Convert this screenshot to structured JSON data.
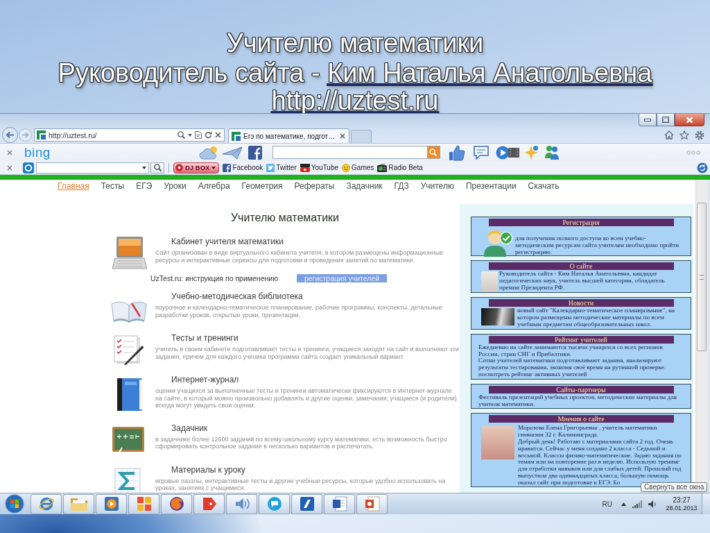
{
  "slide": {
    "title": "Учителю математики",
    "subtitle": "Руководитель сайта - ",
    "author_link": "Ким Наталья Анатольевна",
    "url_link": "http://uztest.ru"
  },
  "browser": {
    "address": "http://uztest.ru/",
    "tabs": [
      {
        "label": "Егэ по математике, подгот…",
        "selected": true
      }
    ],
    "toolbar": {
      "logo": "bing"
    },
    "links_bar": {
      "dj_button": "DJ BOX",
      "links": [
        {
          "kind": "facebook",
          "label": "Facebook"
        },
        {
          "kind": "twitter",
          "label": "Twitter"
        },
        {
          "kind": "youtube",
          "label": "YouTube"
        },
        {
          "kind": "games",
          "label": "Games"
        },
        {
          "kind": "radio",
          "label": "Radio Beta"
        }
      ]
    }
  },
  "nav": [
    {
      "label": "Главная",
      "selected": true
    },
    {
      "label": "Тесты",
      "selected": false
    },
    {
      "label": "ЕГЭ",
      "selected": false
    },
    {
      "label": "Уроки",
      "selected": false
    },
    {
      "label": "Алгебра",
      "selected": false
    },
    {
      "label": "Геометрия",
      "selected": false
    },
    {
      "label": "Рефераты",
      "selected": false
    },
    {
      "label": "Задачник",
      "selected": false
    },
    {
      "label": "ГДЗ",
      "selected": false
    },
    {
      "label": "Учителю",
      "selected": false
    },
    {
      "label": "Презентации",
      "selected": false
    },
    {
      "label": "Скачать",
      "selected": false
    }
  ],
  "main": {
    "heading": "Учителю математики",
    "sections": [
      {
        "kind": "laptop",
        "title": "Кабинет учителя математики",
        "text": "Сайт организован в виде виртуального кабинета учителя, в котором размещены информационные ресурсы и интерактивные сервисы для подготовки и проведения занятий по математике.",
        "link": "UzTest.ru: инструкция по применению",
        "button": "регистрация учителей"
      },
      {
        "kind": "book",
        "title": "Учебно-методическая библиотека",
        "text": "поурочное и календарно-тематическое планирование, рабочие программы, конспекты, детальные разработки уроков, открытые уроки, презентации."
      },
      {
        "kind": "checklist",
        "title": "Тесты и тренинги",
        "text": "учитель в своем кабинете подготавливает тесты и тренинги, учащиеся заходят на сайт и выполняют эти задания, причем для каждого ученика программа сайта создает уникальный вариант."
      },
      {
        "kind": "journal",
        "title": "Интернет-журнал",
        "text": "оценки учащихся за выполненные тесты и тренинги автоматически фиксируются в Интернет-журнале на сайте, в который можно произвольно добавлять и другие оценки, замечания; учащиеся (и родители) всегда могут увидеть свои оценки."
      },
      {
        "kind": "chalkboard",
        "title": "Задачник",
        "text": "в задачнике более 12600 заданий по всему школьному курсу математики, есть возможность быстро сформировать контрольное задание в несколько вариантов и распечатать."
      },
      {
        "kind": "sigma",
        "title": "Материалы к уроку",
        "text": "игровые паззлы, интерактивные тесты и другие учебные ресурсы, которые удобно использовать на уроках, занятиях с учащимися."
      }
    ]
  },
  "sidebar": {
    "cards": [
      {
        "kind": "icon",
        "title": "Регистрация",
        "paragraphs": [
          {
            "kind": "text",
            "text": "для получения полного доступа ко всем учебно-методическим ресурсам сайта учителям необходимо пройти регистрацию."
          }
        ]
      },
      {
        "kind": "portrait",
        "title": "О сайте",
        "paragraphs": [
          {
            "kind": "text",
            "text": "Руководитель сайта - Ким Наталья Анатольевна, кандидат педагогических наук, учитель высшей категории, обладатель премии Президента РФ."
          }
        ]
      },
      {
        "kind": "picture",
        "title": "Новости",
        "paragraphs": [
          {
            "kind": "text",
            "text": "новый сайт \"Календарно-тематическое планирование\", на котором размещены методические материалы по всем учебным предметам общеобразовательных школ."
          }
        ]
      },
      {
        "kind": "plain",
        "title": "Рейтинг учителей",
        "paragraphs": [
          {
            "kind": "text",
            "text": "Ежедневно на сайте занимаются тысячи учащихся со всех регионов России, стран СНГ и Прибалтики."
          },
          {
            "kind": "text",
            "text": "Сотни учителей математики подготавливают задания, анализируют результаты тестирования, экономя своё время на рутинной проверке."
          },
          {
            "kind": "link",
            "text": "посмотреть рейтинг активных учителей"
          }
        ]
      },
      {
        "kind": "plain",
        "title": "Сайты-партнеры",
        "paragraphs": [
          {
            "kind": "text",
            "text": "Фестиваль презентаций учебных проектов, методические материалы для учителя математики."
          }
        ]
      },
      {
        "kind": "review",
        "title": "Мнения о сайте",
        "paragraphs": [
          {
            "kind": "text",
            "text": "Морозова Елена Григорьевна , учитель математики гимназии 32 г. Калининграда."
          },
          {
            "kind": "text",
            "text": "Добрый день! Работаю с материалами сайта 2 год. Очень нравится. Сейчас у меня создано 2 класса - Седьмой и восьмой. Классы физико-математические. Задаю задания по темам или на повторение раз в неделю. Использую тренинг для отработки навыков или для слабых детей. Прошлый год выпустила два одиннадцатых класса, большую помощь оказал сайт при подготовке к ЕГЭ. Бо"
          }
        ]
      }
    ]
  },
  "taskbar": {
    "apps": [
      {
        "kind": "browser"
      },
      {
        "kind": "folder"
      },
      {
        "kind": "player"
      },
      {
        "kind": "tiles"
      },
      {
        "kind": "globe"
      },
      {
        "kind": "tag"
      },
      {
        "kind": "speaker"
      },
      {
        "kind": "chat"
      },
      {
        "kind": "slash"
      },
      {
        "kind": "word"
      },
      {
        "kind": "slides"
      }
    ],
    "language": "RU",
    "time": "23:27",
    "date": "28.01.2013",
    "tooltip": "Свернуть все окна"
  }
}
